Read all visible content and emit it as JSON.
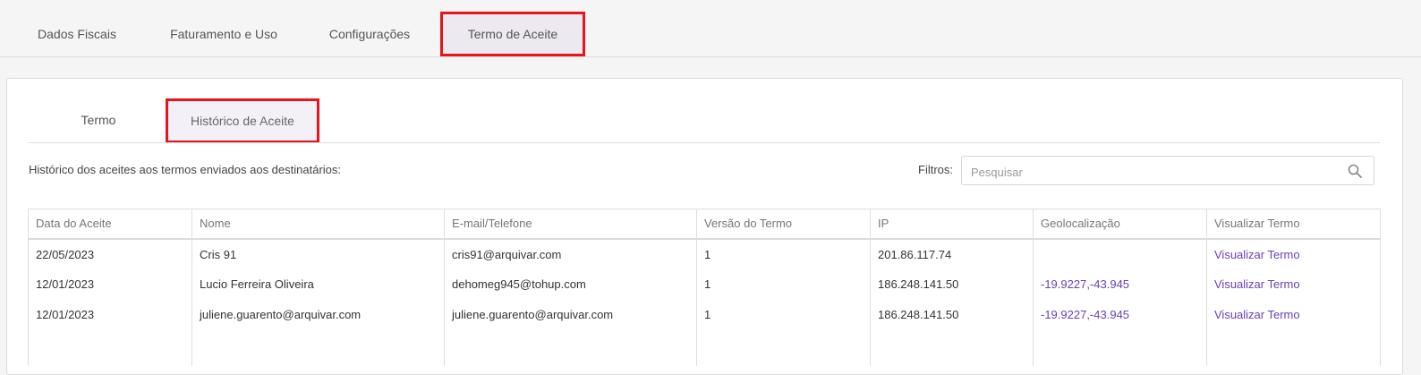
{
  "top_tabs": [
    {
      "label": "Dados Fiscais"
    },
    {
      "label": "Faturamento e Uso"
    },
    {
      "label": "Configurações"
    },
    {
      "label": "Termo de Aceite"
    }
  ],
  "sub_tabs": [
    {
      "label": "Termo"
    },
    {
      "label": "Histórico de Aceite"
    }
  ],
  "description": "Histórico dos aceites aos termos enviados aos destinatários:",
  "filters": {
    "label": "Filtros:",
    "placeholder": "Pesquisar"
  },
  "table": {
    "columns": [
      "Data do Aceite",
      "Nome",
      "E-mail/Telefone",
      "Versão do Termo",
      "IP",
      "Geolocalização",
      "Visualizar Termo"
    ],
    "rows": [
      {
        "date": "22/05/2023",
        "name": "Cris 91",
        "contact": "cris91@arquivar.com",
        "version": "1",
        "ip": "201.86.117.74",
        "geo": "",
        "view": "Visualizar Termo"
      },
      {
        "date": "12/01/2023",
        "name": "Lucio Ferreira Oliveira",
        "contact": "dehomeg945@tohup.com",
        "version": "1",
        "ip": "186.248.141.50",
        "geo": "-19.9227,-43.945",
        "view": "Visualizar Termo"
      },
      {
        "date": "12/01/2023",
        "name": "juliene.guarento@arquivar.com",
        "contact": "juliene.guarento@arquivar.com",
        "version": "1",
        "ip": "186.248.141.50",
        "geo": "-19.9227,-43.945",
        "view": "Visualizar Termo"
      }
    ]
  },
  "colors": {
    "highlight_frame": "#e8141c",
    "link": "#6a3fb8"
  }
}
